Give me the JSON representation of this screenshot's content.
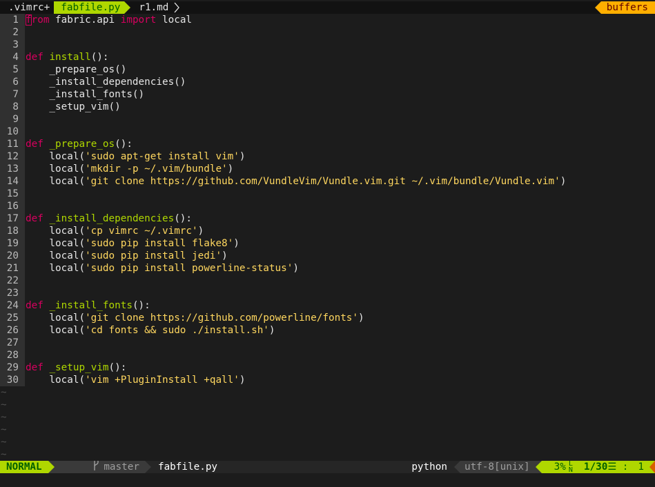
{
  "tabline": {
    "tabs": [
      {
        "label": ".vimrc+"
      },
      {
        "label": "fabfile.py"
      },
      {
        "label": "r1.md"
      }
    ],
    "buffers_label": "buffers"
  },
  "editor": {
    "lines": [
      {
        "n": "1",
        "tokens": [
          {
            "t": "f",
            "c": "cursor"
          },
          {
            "t": "rom",
            "c": "kw"
          },
          {
            "t": " fabric.api ",
            "c": ""
          },
          {
            "t": "import",
            "c": "kw"
          },
          {
            "t": " local",
            "c": ""
          }
        ]
      },
      {
        "n": "2",
        "tokens": []
      },
      {
        "n": "3",
        "tokens": []
      },
      {
        "n": "4",
        "tokens": [
          {
            "t": "def",
            "c": "kw"
          },
          {
            "t": " ",
            "c": ""
          },
          {
            "t": "install",
            "c": "fn"
          },
          {
            "t": "():",
            "c": ""
          }
        ]
      },
      {
        "n": "5",
        "tokens": [
          {
            "t": "    _prepare_os()",
            "c": ""
          }
        ]
      },
      {
        "n": "6",
        "tokens": [
          {
            "t": "    _install_dependencies()",
            "c": ""
          }
        ]
      },
      {
        "n": "7",
        "tokens": [
          {
            "t": "    _install_fonts()",
            "c": ""
          }
        ]
      },
      {
        "n": "8",
        "tokens": [
          {
            "t": "    _setup_vim()",
            "c": ""
          }
        ]
      },
      {
        "n": "9",
        "tokens": []
      },
      {
        "n": "10",
        "tokens": []
      },
      {
        "n": "11",
        "tokens": [
          {
            "t": "def",
            "c": "kw"
          },
          {
            "t": " ",
            "c": ""
          },
          {
            "t": "_prepare_os",
            "c": "fn"
          },
          {
            "t": "():",
            "c": ""
          }
        ]
      },
      {
        "n": "12",
        "tokens": [
          {
            "t": "    local(",
            "c": ""
          },
          {
            "t": "'sudo apt-get install vim'",
            "c": "str"
          },
          {
            "t": ")",
            "c": ""
          }
        ]
      },
      {
        "n": "13",
        "tokens": [
          {
            "t": "    local(",
            "c": ""
          },
          {
            "t": "'mkdir -p ~/.vim/bundle'",
            "c": "str"
          },
          {
            "t": ")",
            "c": ""
          }
        ]
      },
      {
        "n": "14",
        "tokens": [
          {
            "t": "    local(",
            "c": ""
          },
          {
            "t": "'git clone https://github.com/VundleVim/Vundle.vim.git ~/.vim/bundle/Vundle.vim'",
            "c": "str"
          },
          {
            "t": ")",
            "c": ""
          }
        ]
      },
      {
        "n": "15",
        "tokens": []
      },
      {
        "n": "16",
        "tokens": []
      },
      {
        "n": "17",
        "tokens": [
          {
            "t": "def",
            "c": "kw"
          },
          {
            "t": " ",
            "c": ""
          },
          {
            "t": "_install_dependencies",
            "c": "fn"
          },
          {
            "t": "():",
            "c": ""
          }
        ]
      },
      {
        "n": "18",
        "tokens": [
          {
            "t": "    local(",
            "c": ""
          },
          {
            "t": "'cp vimrc ~/.vimrc'",
            "c": "str"
          },
          {
            "t": ")",
            "c": ""
          }
        ]
      },
      {
        "n": "19",
        "tokens": [
          {
            "t": "    local(",
            "c": ""
          },
          {
            "t": "'sudo pip install flake8'",
            "c": "str"
          },
          {
            "t": ")",
            "c": ""
          }
        ]
      },
      {
        "n": "20",
        "tokens": [
          {
            "t": "    local(",
            "c": ""
          },
          {
            "t": "'sudo pip install jedi'",
            "c": "str"
          },
          {
            "t": ")",
            "c": ""
          }
        ]
      },
      {
        "n": "21",
        "tokens": [
          {
            "t": "    local(",
            "c": ""
          },
          {
            "t": "'sudo pip install powerline-status'",
            "c": "str"
          },
          {
            "t": ")",
            "c": ""
          }
        ]
      },
      {
        "n": "22",
        "tokens": []
      },
      {
        "n": "23",
        "tokens": []
      },
      {
        "n": "24",
        "tokens": [
          {
            "t": "def",
            "c": "kw"
          },
          {
            "t": " ",
            "c": ""
          },
          {
            "t": "_install_fonts",
            "c": "fn"
          },
          {
            "t": "():",
            "c": ""
          }
        ]
      },
      {
        "n": "25",
        "tokens": [
          {
            "t": "    local(",
            "c": ""
          },
          {
            "t": "'git clone https://github.com/powerline/fonts'",
            "c": "str"
          },
          {
            "t": ")",
            "c": ""
          }
        ]
      },
      {
        "n": "26",
        "tokens": [
          {
            "t": "    local(",
            "c": ""
          },
          {
            "t": "'cd fonts && sudo ./install.sh'",
            "c": "str"
          },
          {
            "t": ")",
            "c": ""
          }
        ]
      },
      {
        "n": "27",
        "tokens": []
      },
      {
        "n": "28",
        "tokens": []
      },
      {
        "n": "29",
        "tokens": [
          {
            "t": "def",
            "c": "kw"
          },
          {
            "t": " ",
            "c": ""
          },
          {
            "t": "_setup_vim",
            "c": "fn"
          },
          {
            "t": "():",
            "c": ""
          }
        ]
      },
      {
        "n": "30",
        "tokens": [
          {
            "t": "    local(",
            "c": ""
          },
          {
            "t": "'vim +PluginInstall +qall'",
            "c": "str"
          },
          {
            "t": ")",
            "c": ""
          }
        ]
      }
    ],
    "empty_marker": "~",
    "empty_rows": 6
  },
  "statusline": {
    "mode": "NORMAL",
    "branch_icon": "branch-icon",
    "branch": "master",
    "filename": "fabfile.py",
    "filetype": "python",
    "encoding": "utf-8[unix]",
    "percent": "3%",
    "ln_icon": "line-number-icon",
    "position": "1/30",
    "col_sep": "☰ :",
    "column": "1"
  },
  "colors": {
    "keyword": "#d7005f",
    "function": "#afd700",
    "string": "#ffd75f",
    "accent_green": "#afd700",
    "accent_orange": "#ffaf00"
  }
}
